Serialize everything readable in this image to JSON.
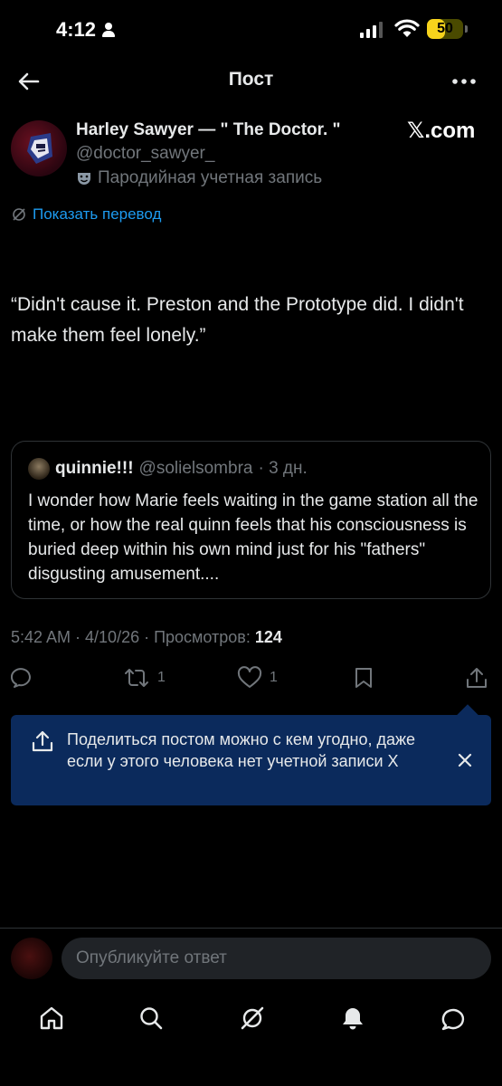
{
  "status_bar": {
    "time": "4:12",
    "battery": "50",
    "battery_level_percent": 50
  },
  "header": {
    "title": "Пост"
  },
  "author": {
    "name": "Harley Sawyer — \" The Doctor. \"",
    "handle": "@doctor_sawyer_",
    "parody_label": "Пародийная учетная запись",
    "watermark": "𝕏.com"
  },
  "translate_label": "Показать перевод",
  "post": {
    "text": "“Didn't cause it. Preston and the Prototype did. I didn't make them feel lonely.”"
  },
  "quote": {
    "name": "quinnie!!!",
    "handle": "@solielsombra",
    "time": "· 3 дн.",
    "text": "I wonder how Marie feels waiting in the game station all the time, or how the real quinn feels that his consciousness is buried deep within his own mind just for his \"fathers\" disgusting amusement...."
  },
  "meta": {
    "time_date": "5:42 AM · 4/10/26 · Просмотров:",
    "views": "124"
  },
  "actions": {
    "reposts": "1",
    "likes": "1"
  },
  "toast": {
    "text": "Поделиться постом можно с кем угодно, даже если у этого человека нет учетной записи X"
  },
  "reply": {
    "placeholder": "Опубликуйте ответ"
  },
  "nav": [
    "home-icon",
    "search-icon",
    "grok-icon",
    "notifications-icon",
    "messages-icon"
  ],
  "colors": {
    "background": "#000000",
    "link": "#1d9bf0",
    "muted": "#71767b",
    "toast_bg": "#0b2a5c",
    "battery": "#f7d31c"
  }
}
